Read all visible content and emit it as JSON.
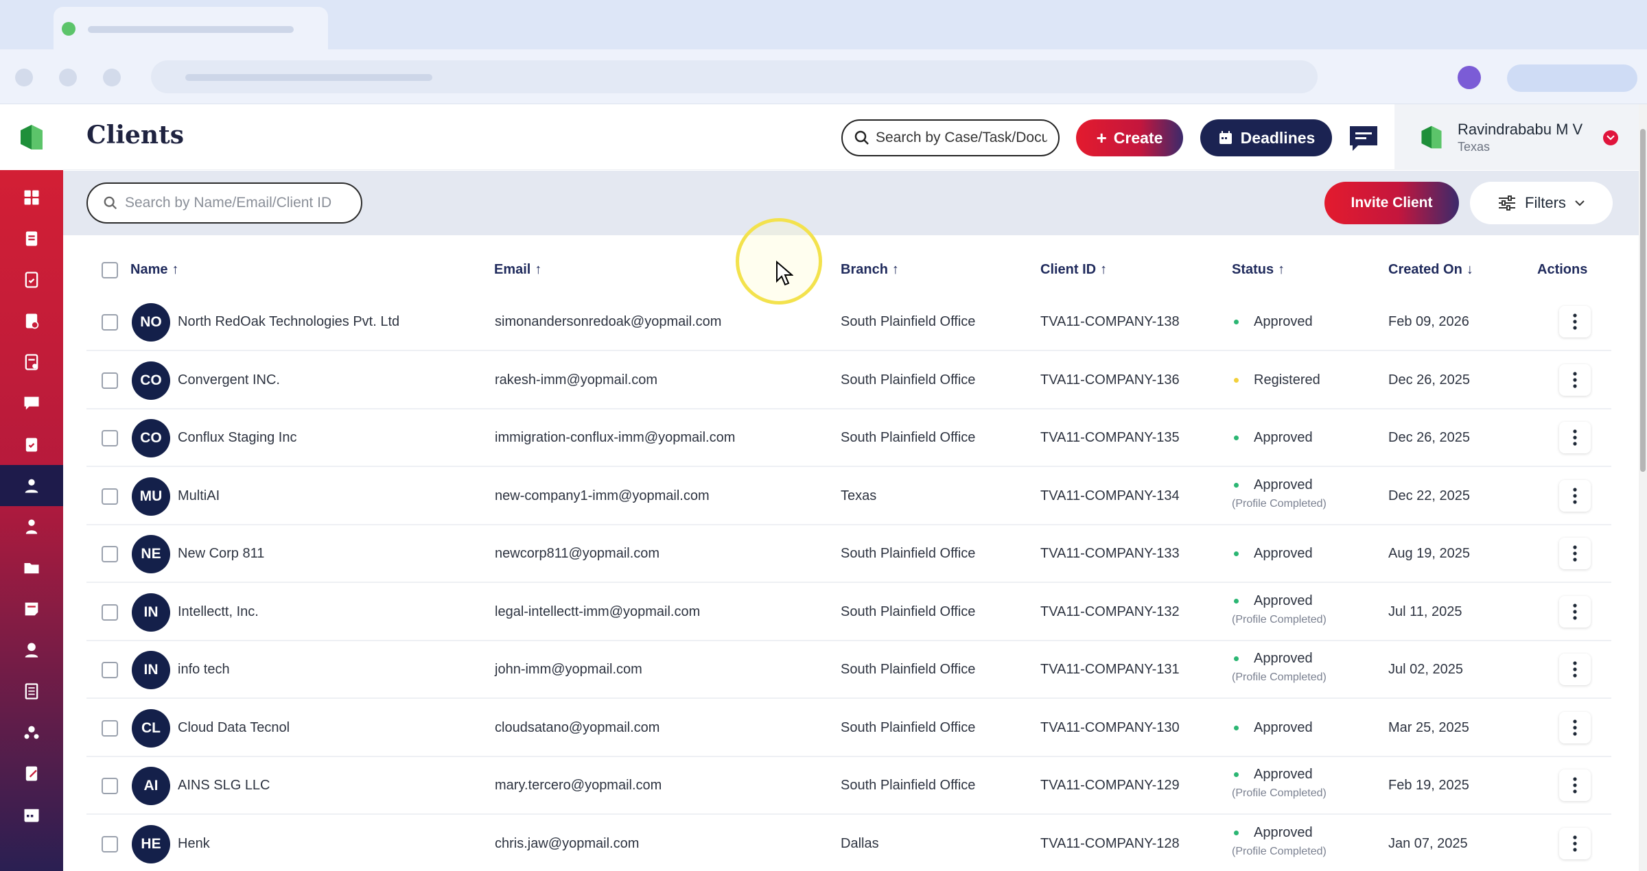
{
  "header": {
    "title": "Clients",
    "search_placeholder": "Search by Case/Task/Document",
    "create_label": "Create",
    "deadlines_label": "Deadlines"
  },
  "user": {
    "name": "Ravindrababu M V",
    "location": "Texas"
  },
  "toolbar": {
    "client_search_placeholder": "Search by Name/Email/Client ID",
    "invite_label": "Invite Client",
    "filters_label": "Filters"
  },
  "table": {
    "columns": {
      "name": "Name",
      "email": "Email",
      "branch": "Branch",
      "client_id": "Client ID",
      "status": "Status",
      "created_on": "Created On",
      "actions": "Actions"
    },
    "rows": [
      {
        "initials": "NO",
        "name": "North RedOak Technologies Pvt. Ltd",
        "email": "simonandersonredoak@yopmail.com",
        "branch": "South Plainfield Office",
        "client_id": "TVA11-COMPANY-138",
        "status": "Approved",
        "status_sub": "",
        "created_on": "Feb 09, 2026"
      },
      {
        "initials": "CO",
        "name": "Convergent INC.",
        "email": "rakesh-imm@yopmail.com",
        "branch": "South Plainfield Office",
        "client_id": "TVA11-COMPANY-136",
        "status": "Registered",
        "status_sub": "",
        "created_on": "Dec 26, 2025"
      },
      {
        "initials": "CO",
        "name": "Conflux Staging Inc",
        "email": "immigration-conflux-imm@yopmail.com",
        "branch": "South Plainfield Office",
        "client_id": "TVA11-COMPANY-135",
        "status": "Approved",
        "status_sub": "",
        "created_on": "Dec 26, 2025"
      },
      {
        "initials": "MU",
        "name": "MultiAI",
        "email": "new-company1-imm@yopmail.com",
        "branch": "Texas",
        "client_id": "TVA11-COMPANY-134",
        "status": "Approved",
        "status_sub": "(Profile Completed)",
        "created_on": "Dec 22, 2025"
      },
      {
        "initials": "NE",
        "name": "New Corp 811",
        "email": "newcorp811@yopmail.com",
        "branch": "South Plainfield Office",
        "client_id": "TVA11-COMPANY-133",
        "status": "Approved",
        "status_sub": "",
        "created_on": "Aug 19, 2025"
      },
      {
        "initials": "IN",
        "name": "Intellectt, Inc.",
        "email": "legal-intellectt-imm@yopmail.com",
        "branch": "South Plainfield Office",
        "client_id": "TVA11-COMPANY-132",
        "status": "Approved",
        "status_sub": "(Profile Completed)",
        "created_on": "Jul 11, 2025"
      },
      {
        "initials": "IN",
        "name": "info tech",
        "email": "john-imm@yopmail.com",
        "branch": "South Plainfield Office",
        "client_id": "TVA11-COMPANY-131",
        "status": "Approved",
        "status_sub": "(Profile Completed)",
        "created_on": "Jul 02, 2025"
      },
      {
        "initials": "CL",
        "name": "Cloud Data Tecnol",
        "email": "cloudsatano@yopmail.com",
        "branch": "South Plainfield Office",
        "client_id": "TVA11-COMPANY-130",
        "status": "Approved",
        "status_sub": "",
        "created_on": "Mar 25, 2025"
      },
      {
        "initials": "AI",
        "name": "AINS SLG LLC",
        "email": "mary.tercero@yopmail.com",
        "branch": "South Plainfield Office",
        "client_id": "TVA11-COMPANY-129",
        "status": "Approved",
        "status_sub": "(Profile Completed)",
        "created_on": "Feb 19, 2025"
      },
      {
        "initials": "HE",
        "name": "Henk",
        "email": "chris.jaw@yopmail.com",
        "branch": "Dallas",
        "client_id": "TVA11-COMPANY-128",
        "status": "Approved",
        "status_sub": "(Profile Completed)",
        "created_on": "Jan 07, 2025"
      }
    ]
  },
  "colors": {
    "approved": "#2bb673",
    "registered": "#f2d03b",
    "brand_red": "#e31b2e",
    "brand_navy": "#1b2352"
  },
  "icons": {
    "sidebar": [
      "dashboard-icon",
      "cases-icon",
      "tasks-icon",
      "documents-icon",
      "forms-icon",
      "messages-icon",
      "checklist-icon",
      "clients-icon",
      "users-icon",
      "folder-icon",
      "notes-icon",
      "employees-icon",
      "reports-icon",
      "settings-icon",
      "templates-icon",
      "calendar-icon"
    ]
  }
}
